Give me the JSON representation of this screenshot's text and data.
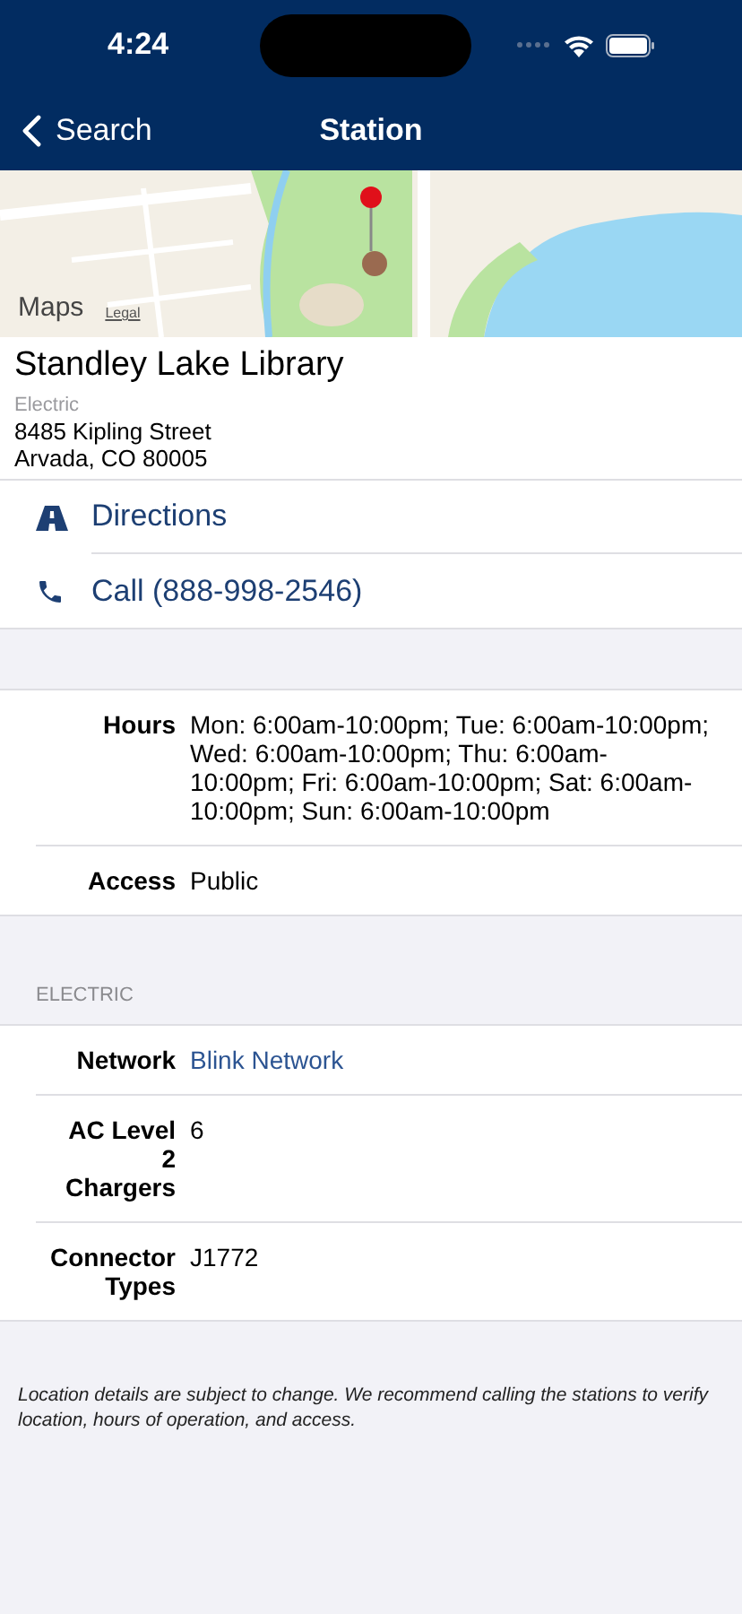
{
  "status_bar": {
    "time": "4:24"
  },
  "nav": {
    "back": "Search",
    "title": "Station"
  },
  "map": {
    "logo": "Maps",
    "legal": "Legal"
  },
  "station": {
    "name": "Standley Lake Library",
    "type": "Electric",
    "address_lines": [
      "8485 Kipling Street",
      "Arvada, CO 80005"
    ]
  },
  "actions": [
    {
      "kind": "directions",
      "label": "Directions"
    },
    {
      "kind": "call",
      "label": "Call (888-998-2546)"
    }
  ],
  "details": [
    {
      "label": "Hours",
      "value": "Mon: 6:00am-10:00pm; Tue: 6:00am-10:00pm; Wed: 6:00am-10:00pm; Thu: 6:00am-10:00pm; Fri: 6:00am-10:00pm; Sat: 6:00am-10:00pm; Sun: 6:00am-10:00pm",
      "kind": "text"
    },
    {
      "label": "Access",
      "value": "Public",
      "kind": "text"
    }
  ],
  "electric": {
    "header": "ELECTRIC",
    "rows": [
      {
        "label": "Network",
        "value": "Blink Network",
        "kind": "link"
      },
      {
        "label": "AC Level 2 Chargers",
        "value": "6",
        "kind": "text"
      },
      {
        "label": "Connector Types",
        "value": "J1772",
        "kind": "text"
      }
    ]
  },
  "footnote": "Location details are subject to change. We recommend calling the stations to verify location, hours of operation, and access."
}
